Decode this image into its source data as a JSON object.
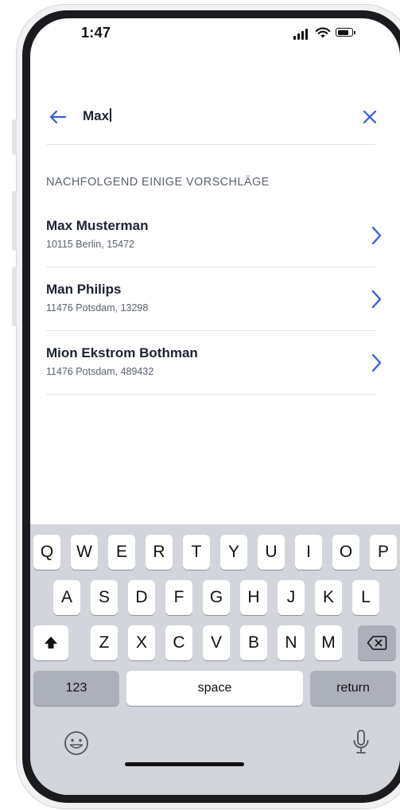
{
  "status_bar": {
    "time": "1:47",
    "battery_level": 0.85
  },
  "search": {
    "query": "Max"
  },
  "section_heading": "NACHFOLGEND EINIGE VORSCHLÄGE",
  "results": [
    {
      "name": "Max Musterman",
      "address": "10115 Berlin, 15472"
    },
    {
      "name": "Man Philips",
      "address": "11476 Potsdam, 13298"
    },
    {
      "name": "Mion Ekstrom Bothman",
      "address": "11476 Potsdam, 489432"
    }
  ],
  "keyboard": {
    "row1": [
      "Q",
      "W",
      "E",
      "R",
      "T",
      "Y",
      "U",
      "I",
      "O",
      "P"
    ],
    "row2": [
      "A",
      "S",
      "D",
      "F",
      "G",
      "H",
      "J",
      "K",
      "L"
    ],
    "row3": [
      "Z",
      "X",
      "C",
      "V",
      "B",
      "N",
      "M"
    ],
    "numbers_label": "123",
    "space_label": "space",
    "return_label": "return"
  },
  "colors": {
    "accent": "#2f5de6",
    "text": "#1b2230",
    "muted": "#5b6170",
    "keyboard_bg": "#d2d5db"
  },
  "icons": [
    "back-arrow-icon",
    "close-icon",
    "chevron-right-icon",
    "shift-icon",
    "backspace-icon",
    "emoji-icon",
    "microphone-icon",
    "signal-icon",
    "wifi-icon",
    "battery-icon"
  ]
}
